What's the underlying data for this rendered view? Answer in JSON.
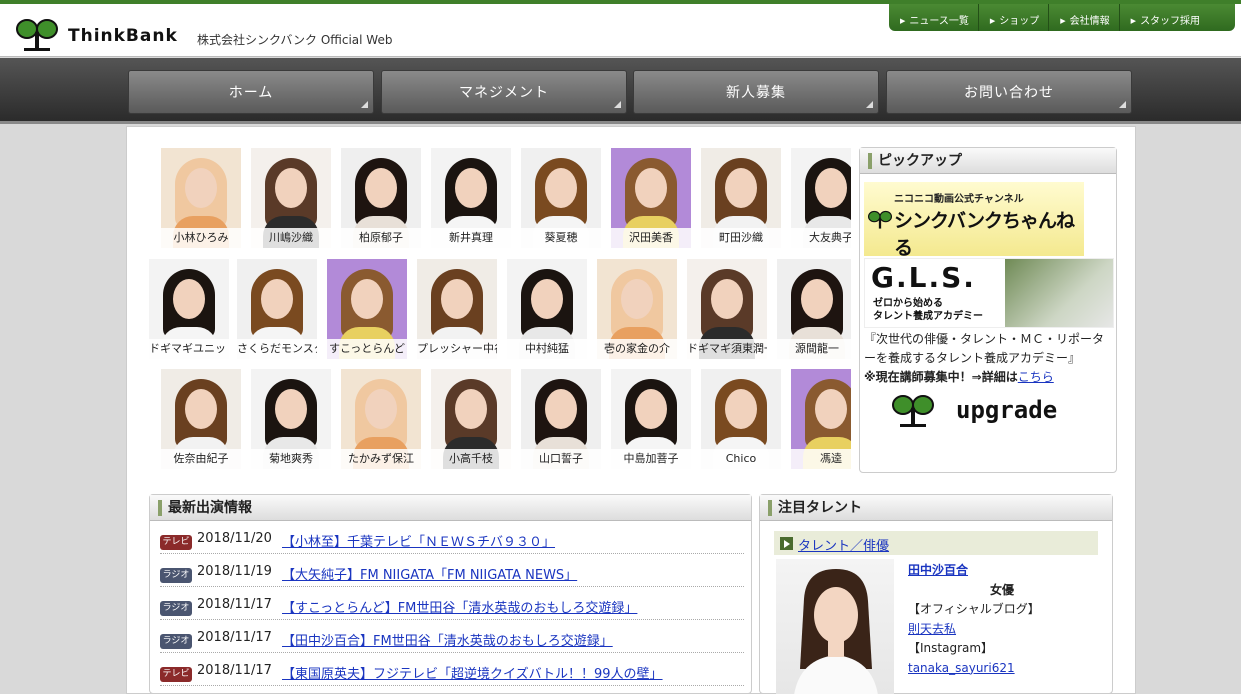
{
  "header": {
    "logo_text": "ThinkBank",
    "company": "株式会社シンクバンク Official Web",
    "top_links": [
      "ニュース一覧",
      "ショップ",
      "会社情報",
      "スタッフ採用"
    ]
  },
  "main_nav": [
    "ホーム",
    "マネジメント",
    "新人募集",
    "お問い合わせ"
  ],
  "talents": [
    [
      "小林ひろみ",
      "川嶋沙織",
      "柏原郁子",
      "新井真理",
      "葵夏穂",
      "沢田美香",
      "町田沙織",
      "大友典子"
    ],
    [
      "ドギマギユニット",
      "さくらだモンスター",
      "すこっとらんど",
      "プレッシャー中谷",
      "中村純猛",
      "壱の家金の介",
      "ドギマギ須東潤一",
      "源間龍一"
    ],
    [
      "佐奈由紀子",
      "菊地爽秀",
      "たかみず保江",
      "小高千枝",
      "山口誓子",
      "中島加菩子",
      "Chico",
      "馮逵"
    ]
  ],
  "pickup": {
    "title": "ピックアップ",
    "nico_small": "ニコニコ動画公式チャンネル",
    "nico_big": "シンクバンクちゃんねる",
    "gls_title": "G.L.S.",
    "gls_sub1": "ゼロから始める",
    "gls_sub2": "タレント養成アカデミー",
    "desc": "『次世代の俳優・タレント・ＭＣ・リポーターを養成するタレント養成アカデミー』",
    "notice": "※現在講師募集中！⇒詳細は",
    "notice_link": "こちら",
    "upgrade": "upgrade"
  },
  "news": {
    "title": "最新出演情報",
    "items": [
      {
        "type": "テレビ",
        "date": "2018/11/20",
        "title": "【小林至】千葉テレビ「ＮＥＷＳチバ９３０」"
      },
      {
        "type": "ラジオ",
        "date": "2018/11/19",
        "title": "【大矢純子】FM NIIGATA「FM NIIGATA NEWS」"
      },
      {
        "type": "ラジオ",
        "date": "2018/11/17",
        "title": "【すこっとらんど】FM世田谷「清水英哉のおもしろ交遊録」"
      },
      {
        "type": "ラジオ",
        "date": "2018/11/17",
        "title": "【田中沙百合】FM世田谷「清水英哉のおもしろ交遊録」"
      },
      {
        "type": "テレビ",
        "date": "2018/11/17",
        "title": "【東国原英夫】フジテレビ「超逆境クイズバトル！！99人の壁」"
      }
    ]
  },
  "featured": {
    "title": "注目タレント",
    "category": "タレント／俳優",
    "name": "田中沙百合",
    "role": "女優",
    "blog_label": "【オフィシャルブログ】",
    "blog_link": "則天去私",
    "ig_label": "【Instagram】",
    "ig_link": "tanaka_sayuri621"
  },
  "colors": {
    "brand_green": "#3f7f2a",
    "tv_badge": "#8b2a2a",
    "radio_badge": "#4a5570",
    "link": "#1a35c0"
  }
}
